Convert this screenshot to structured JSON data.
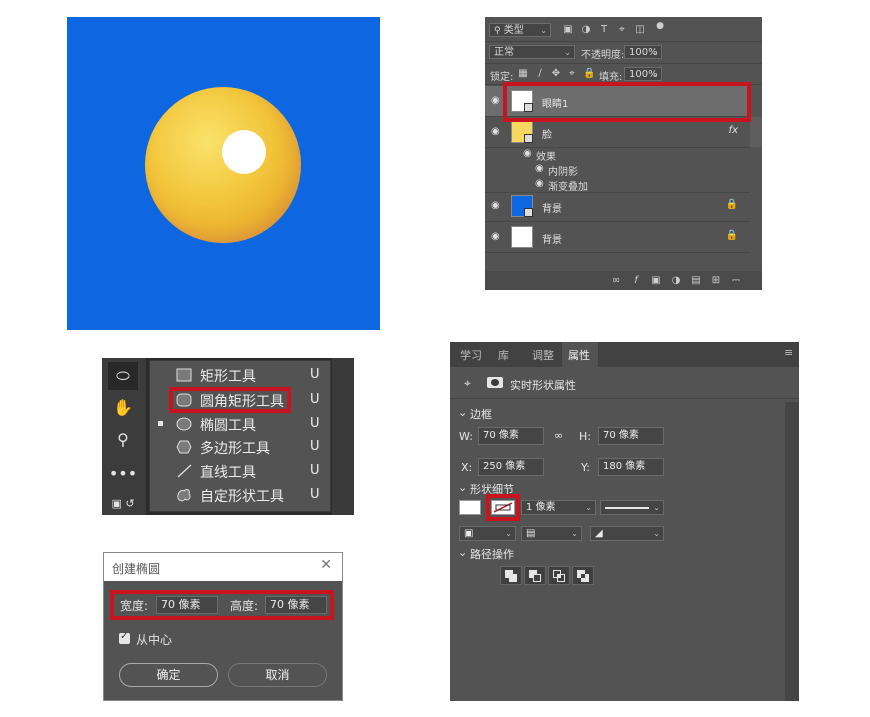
{
  "layers_panel": {
    "filter_kind": "类型",
    "blend_mode": "正常",
    "opacity_label": "不透明度:",
    "opacity_value": "100%",
    "lock_label": "锁定:",
    "fill_label": "填充:",
    "fill_value": "100%",
    "layers": [
      {
        "name": "眼睛1",
        "thumb_color": "#ffffff",
        "selected": true
      },
      {
        "name": "脸",
        "thumb_color": "#f7d85e",
        "fx": "fx"
      },
      {
        "name": "背景",
        "thumb_color": "#0f66e1",
        "locked": true
      },
      {
        "name": "背景",
        "thumb_color": "#ffffff",
        "locked": true
      }
    ],
    "effects_label": "效果",
    "effects": [
      "内阴影",
      "渐变叠加"
    ]
  },
  "tools": {
    "items": [
      {
        "label": "矩形工具",
        "key": "U"
      },
      {
        "label": "圆角矩形工具",
        "key": "U"
      },
      {
        "label": "椭圆工具",
        "key": "U"
      },
      {
        "label": "多边形工具",
        "key": "U"
      },
      {
        "label": "直线工具",
        "key": "U"
      },
      {
        "label": "自定形状工具",
        "key": "U"
      }
    ]
  },
  "dialog": {
    "title": "创建椭圆",
    "width_label": "宽度:",
    "width_value": "70 像素",
    "height_label": "高度:",
    "height_value": "70 像素",
    "from_center_label": "从中心",
    "ok_label": "确定",
    "cancel_label": "取消"
  },
  "properties": {
    "tabs": [
      "学习",
      "库",
      "调整",
      "属性"
    ],
    "header": "实时形状属性",
    "section_bbox": "边框",
    "w_label": "W:",
    "w_value": "70 像素",
    "h_label": "H:",
    "h_value": "70 像素",
    "x_label": "X:",
    "x_value": "250 像素",
    "y_label": "Y:",
    "y_value": "180 像素",
    "section_appearance": "形状细节",
    "stroke_width": "1 像素",
    "section_path": "路径操作"
  },
  "colors": {
    "canvas_bg": "#0f66e1",
    "highlight": "#c8141e",
    "panel_bg": "#535353"
  }
}
